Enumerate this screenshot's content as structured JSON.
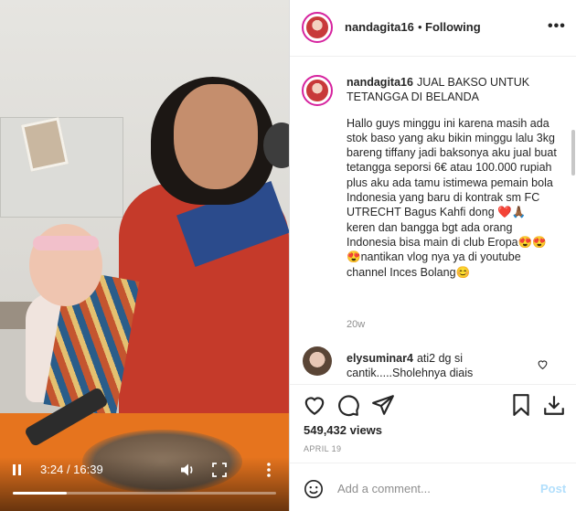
{
  "video": {
    "current_time": "3:24",
    "duration": "16:39",
    "progress": 0.204
  },
  "header": {
    "username": "nandagita16",
    "separator": "•",
    "follow_status": "Following",
    "more_icon": "more-horizontal-icon"
  },
  "caption": {
    "username": "nandagita16",
    "title": "JUAL BAKSO UNTUK TETANGGA DI BELANDA",
    "body": "Hallo guys minggu ini karena masih ada stok baso yang aku bikin minggu lalu 3kg bareng tiffany jadi baksonya aku jual buat tetangga seporsi 6€ atau 100.000 rupiah plus aku ada tamu istimewa pemain bola Indonesia yang baru di kontrak sm FC UTRECHT Bagus Kahfi dong ❤️🙏🏾\nkeren dan bangga bgt ada orang Indonesia bisa main di club Eropa😍😍😍nantikan vlog nya ya di youtube channel Inces Bolang😊",
    "time_ago": "20w"
  },
  "comment": {
    "username": "elysuminar4",
    "text": "ati2 dg si cantik.....Sholehnya diais"
  },
  "stats": {
    "views": "549,432 views",
    "date": "APRIL 19"
  },
  "add_comment": {
    "placeholder": "Add a comment...",
    "post_label": "Post"
  },
  "colors": {
    "accent_disabled": "#b2dffc",
    "ring": "#d6249f",
    "muted": "#8e8e8e"
  }
}
